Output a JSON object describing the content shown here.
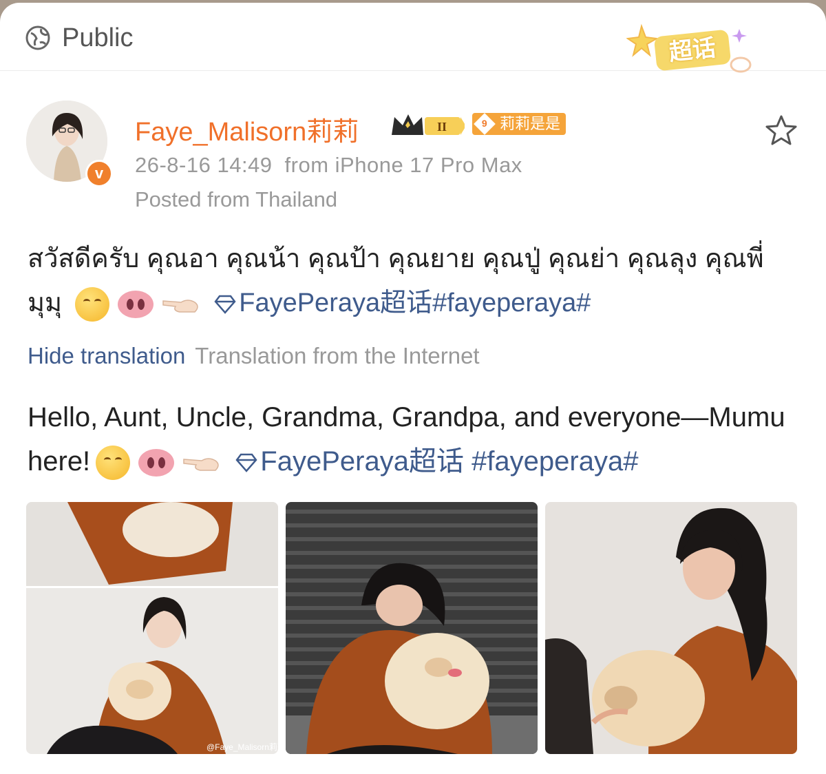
{
  "header": {
    "visibility": "Public",
    "chaohua_badge": "超话"
  },
  "author": {
    "username": "Faye_Malisorn莉莉",
    "fan_badge_level": "9",
    "fan_badge_label": "莉莉是是",
    "date": "26-8-16 14:49",
    "source": "from iPhone 17 Pro Max",
    "location": "Posted from Thailand"
  },
  "post": {
    "thai_text": "สวัสดีครับ คุณอา คุณน้า คุณป้า คุณยาย คุณปู่ คุณย่า คุณลุง คุณพี่ มุมุ",
    "thai_topic": "FayePeraya超话#fayeperaya#",
    "hide_translation": "Hide translation",
    "translation_source": "Translation from the Internet",
    "english_text": "Hello, Aunt, Uncle, Grandma, Grandpa, and everyone—Mumu here!",
    "english_topic": "FayePeraya超话 #fayeperaya#"
  },
  "photos": {
    "watermark": "@Faye_Malisorn莉莉"
  },
  "colors": {
    "accent_orange": "#f0702a",
    "link_blue": "#3f5b8c",
    "meta_gray": "#999999"
  }
}
